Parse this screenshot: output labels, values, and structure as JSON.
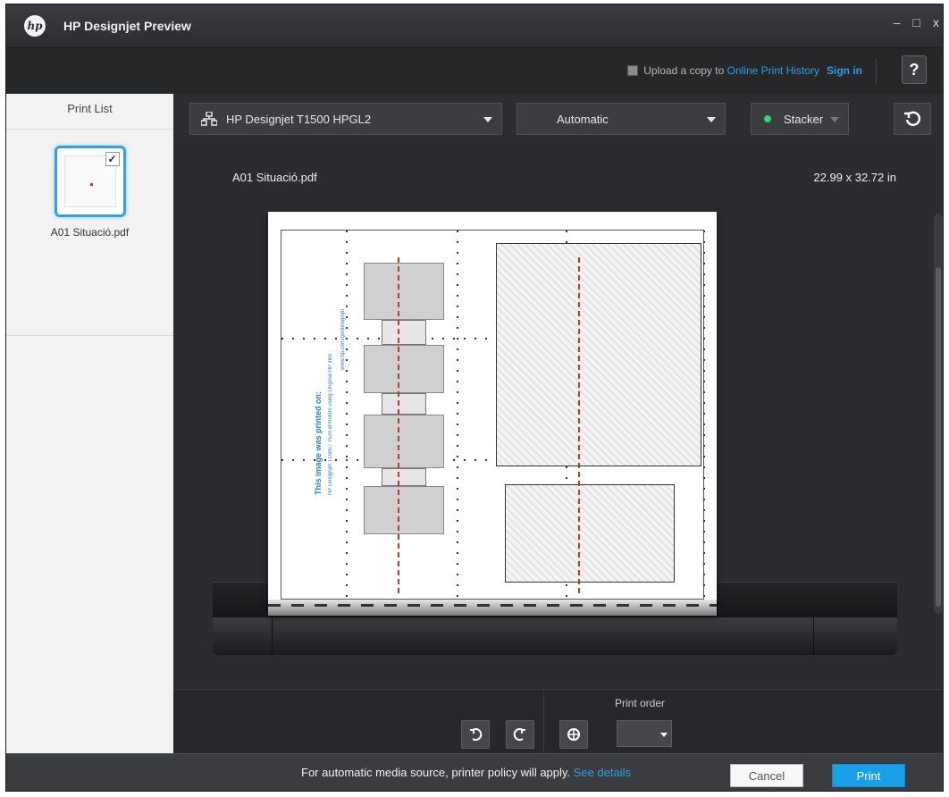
{
  "window": {
    "title": "HP Designjet Preview",
    "logo_text": "hp",
    "minimize": "–",
    "maximize": "□",
    "close": "x"
  },
  "topbar": {
    "upload_prefix": "Upload a copy to",
    "upload_link": "Online Print History",
    "sign_in": "Sign in",
    "help": "?"
  },
  "sidebar": {
    "title": "Print List",
    "items": [
      {
        "label": "A01 Situació.pdf",
        "selected": true
      }
    ]
  },
  "toolbar": {
    "printer": "HP Designjet T1500 HPGL2",
    "media_source": "Automatic",
    "output": "Stacker",
    "output_status_color": "#36d17a"
  },
  "preview": {
    "file_name": "A01 Situació.pdf",
    "size": "22.99 x 32.72 in"
  },
  "controls": {
    "print_order_label": "Print order",
    "print_order_value": ""
  },
  "footer": {
    "policy_text": "For automatic media source, printer policy will apply.",
    "see_details": "See details",
    "cancel": "Cancel",
    "print": "Print"
  },
  "colors": {
    "accent": "#2b9fe0",
    "print_button": "#1aa0e8",
    "background": "#2b2d30"
  }
}
